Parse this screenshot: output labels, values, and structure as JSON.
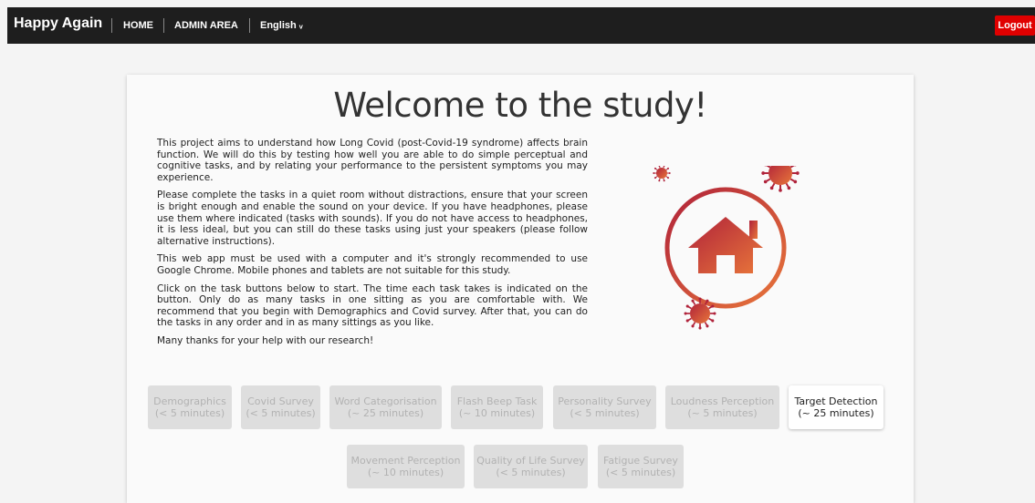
{
  "navbar": {
    "brand": "Happy Again",
    "links": [
      "HOME",
      "ADMIN AREA",
      "English ᵥ"
    ],
    "logout": "Logout"
  },
  "main": {
    "title": "Welcome to the study!",
    "paragraphs": [
      "This project aims to understand how Long Covid (post-Covid-19 syndrome) affects brain function. We will do this by testing how well you are able to do simple perceptual and cognitive tasks, and by relating your performance to the persistent symptoms you may experience.",
      "Please complete the tasks in a quiet room without distractions, ensure that your screen is bright enough and enable the sound on your device. If you have headphones, please use them where indicated (tasks with sounds). If you do not have access to headphones, it is less ideal, but you can still do these tasks using just your speakers (please follow alternative instructions).",
      "This web app must be used with a computer and it's strongly recommended to use Google Chrome. Mobile phones and tablets are not suitable for this study.",
      "Click on the task buttons below to start. The time each task takes is indicated on the button. Only do as many tasks in one sitting as you are comfortable with. We recommend that you begin with Demographics and Covid survey. After that, you can do the tasks in any order and in as many sittings as you like.",
      "Many thanks for your help with our research!"
    ],
    "tasks": [
      {
        "name": "Demographics",
        "time": "(< 5 minutes)",
        "enabled": false
      },
      {
        "name": "Covid Survey",
        "time": "(< 5 minutes)",
        "enabled": false
      },
      {
        "name": "Word Categorisation",
        "time": "(~ 25 minutes)",
        "enabled": false
      },
      {
        "name": "Flash Beep Task",
        "time": "(~ 10 minutes)",
        "enabled": false
      },
      {
        "name": "Personality Survey",
        "time": "(< 5 minutes)",
        "enabled": false
      },
      {
        "name": "Loudness Perception",
        "time": "(~ 5 minutes)",
        "enabled": false
      },
      {
        "name": "Target Detection",
        "time": "(~ 25 minutes)",
        "enabled": true
      },
      {
        "name": "Movement Perception",
        "time": "(~ 10 minutes)",
        "enabled": false
      },
      {
        "name": "Quality of Life Survey",
        "time": "(< 5 minutes)",
        "enabled": false
      },
      {
        "name": "Fatigue Survey",
        "time": "(< 5 minutes)",
        "enabled": false
      }
    ]
  },
  "colors": {
    "navbar": "#1e1e1e",
    "logout": "#e00000",
    "gradient_start": "#b0223a",
    "gradient_end": "#e8763a"
  },
  "icons": [
    "home-icon",
    "virus-icon"
  ]
}
